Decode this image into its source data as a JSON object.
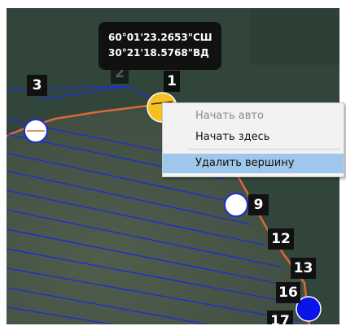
{
  "coordinate_tooltip": {
    "latitude": "60°01'23.2653\"СШ",
    "longitude": "30°21'18.5768\"ВД"
  },
  "waypoint_labels": {
    "wp1": "1",
    "wp2": "2",
    "wp3": "3",
    "wp9": "9",
    "wp12": "12",
    "wp13": "13",
    "wp16": "16",
    "wp17": "17"
  },
  "context_menu": {
    "items": [
      {
        "label": "Начать авто",
        "enabled": false
      },
      {
        "label": "Начать здесь",
        "enabled": true
      },
      {
        "label": "Удалить вершину",
        "enabled": true,
        "highlighted": true
      }
    ]
  },
  "colors": {
    "selected_vertex": "#f6c020",
    "vertex": "#ffffff",
    "home_marker": "#0a14e6",
    "survey_lines": "#1c2fd2",
    "polygon_edge": "#d86a3a",
    "menu_highlight": "#9fc7ec"
  }
}
